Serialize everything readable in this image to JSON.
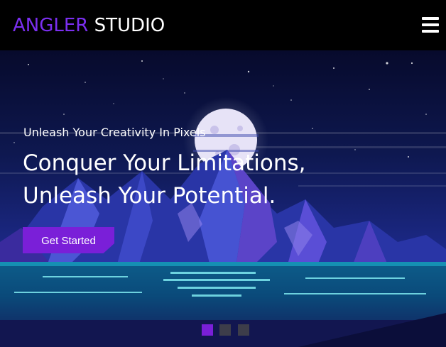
{
  "header": {
    "brand_part1": "ANGLER",
    "brand_part2": "STUDIO",
    "menu_icon": "hamburger-menu-icon"
  },
  "hero": {
    "kicker": "Unleash Your Creativity In Pixels",
    "headline_line1": "Conquer Your Limitations,",
    "headline_line2": "Unleash Your Potential.",
    "cta_label": "Get Started"
  },
  "slider": {
    "slide_count": 3,
    "active_index": 0
  },
  "colors": {
    "accent": "#7b2ff0",
    "button": "#7a1fd8",
    "dot_active": "#7a1fd8",
    "dot_inactive": "#3d3d4a"
  }
}
